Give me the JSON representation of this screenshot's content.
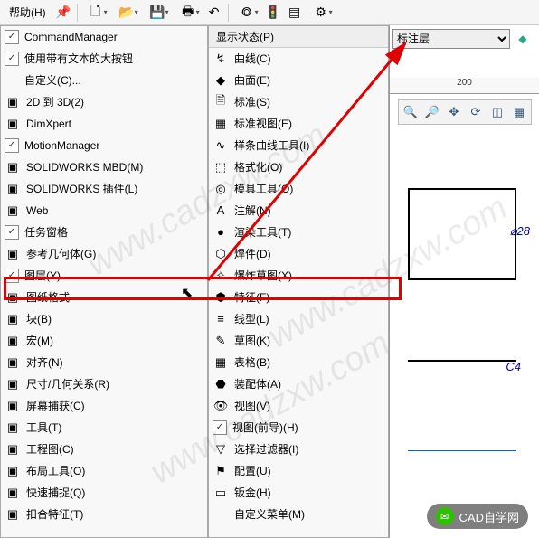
{
  "topbar": {
    "help": "帮助(H)",
    "icons": [
      "pin-icon",
      "new-icon",
      "open-icon",
      "save-icon",
      "print-icon",
      "undo-icon",
      "select-icon",
      "traffic-icon",
      "list-icon",
      "settings-icon"
    ]
  },
  "layer": {
    "selected": "标注层",
    "icon": "layer-stack-icon"
  },
  "ruler": {
    "mark": "200"
  },
  "leftMenu": {
    "items": [
      {
        "chk": true,
        "icon": "",
        "label": "CommandManager",
        "arrow": false
      },
      {
        "chk": true,
        "icon": "",
        "label": "使用带有文本的大按钮",
        "arrow": false
      },
      {
        "chk": null,
        "icon": "",
        "label": "自定义(C)...",
        "arrow": false
      },
      {
        "chk": null,
        "icon": "2d3d-icon",
        "label": "2D 到 3D(2)",
        "arrow": false
      },
      {
        "chk": null,
        "icon": "dim-icon",
        "label": "DimXpert",
        "arrow": false
      },
      {
        "chk": true,
        "icon": "",
        "label": "MotionManager",
        "arrow": false
      },
      {
        "chk": null,
        "icon": "mbd-icon",
        "label": "SOLIDWORKS MBD(M)",
        "arrow": false
      },
      {
        "chk": null,
        "icon": "plugin-icon",
        "label": "SOLIDWORKS 插件(L)",
        "arrow": false
      },
      {
        "chk": null,
        "icon": "web-icon",
        "label": "Web",
        "arrow": false
      },
      {
        "chk": true,
        "icon": "",
        "label": "任务窗格",
        "arrow": false
      },
      {
        "chk": null,
        "icon": "refgeom-icon",
        "label": "参考几何体(G)",
        "arrow": false
      },
      {
        "chk": true,
        "icon": "",
        "label": "图层(Y)",
        "arrow": false
      },
      {
        "chk": null,
        "icon": "sheet-icon",
        "label": "图纸格式",
        "arrow": false
      },
      {
        "chk": null,
        "icon": "block-icon",
        "label": "块(B)",
        "arrow": false
      },
      {
        "chk": null,
        "icon": "macro-icon",
        "label": "宏(M)",
        "arrow": false
      },
      {
        "chk": null,
        "icon": "align-icon",
        "label": "对齐(N)",
        "arrow": false
      },
      {
        "chk": null,
        "icon": "dimrel-icon",
        "label": "尺寸/几何关系(R)",
        "arrow": false
      },
      {
        "chk": null,
        "icon": "capture-icon",
        "label": "屏幕捕获(C)",
        "arrow": false
      },
      {
        "chk": null,
        "icon": "tools-icon",
        "label": "工具(T)",
        "arrow": false
      },
      {
        "chk": null,
        "icon": "drawing-icon",
        "label": "工程图(C)",
        "arrow": false
      },
      {
        "chk": null,
        "icon": "layout-icon",
        "label": "布局工具(O)",
        "arrow": false
      },
      {
        "chk": null,
        "icon": "snap-icon",
        "label": "快速捕捉(Q)",
        "arrow": false
      },
      {
        "chk": null,
        "icon": "fasten-icon",
        "label": "扣合特征(T)",
        "arrow": false
      }
    ]
  },
  "rightMenu": {
    "header": "显示状态(P)",
    "items": [
      {
        "icon": "curve-icon",
        "label": "曲线(C)"
      },
      {
        "icon": "surface-icon",
        "label": "曲面(E)"
      },
      {
        "icon": "standard-icon",
        "label": "标准(S)"
      },
      {
        "icon": "stdview-icon",
        "label": "标准视图(E)"
      },
      {
        "icon": "spline-icon",
        "label": "样条曲线工具(I)"
      },
      {
        "icon": "format-icon",
        "label": "格式化(O)"
      },
      {
        "icon": "mold-icon",
        "label": "模具工具(O)"
      },
      {
        "icon": "annot-icon",
        "label": "注解(N)"
      },
      {
        "icon": "render-icon",
        "label": "渲染工具(T)"
      },
      {
        "icon": "weld-icon",
        "label": "焊件(D)"
      },
      {
        "icon": "explode-icon",
        "label": "爆炸草图(X)"
      },
      {
        "icon": "feature-icon",
        "label": "特征(F)"
      },
      {
        "icon": "linetype-icon",
        "label": "线型(L)"
      },
      {
        "icon": "sketch-icon",
        "label": "草图(K)"
      },
      {
        "icon": "table-icon",
        "label": "表格(B)"
      },
      {
        "icon": "assembly-icon",
        "label": "装配体(A)"
      },
      {
        "icon": "view-icon",
        "label": "视图(V)"
      },
      {
        "icon": "viewfg-icon",
        "label": "视图(前导)(H)",
        "chk": true
      },
      {
        "icon": "filter-icon",
        "label": "选择过滤器(I)"
      },
      {
        "icon": "config-icon",
        "label": "配置(U)"
      },
      {
        "icon": "sheetmetal-icon",
        "label": "钣金(H)"
      }
    ],
    "footer": "自定义菜单(M)"
  },
  "dims": {
    "d1": "⌀28",
    "d2": "C4"
  },
  "badge": {
    "text": "CAD自学网"
  },
  "watermark": "www.cadzxw.com"
}
